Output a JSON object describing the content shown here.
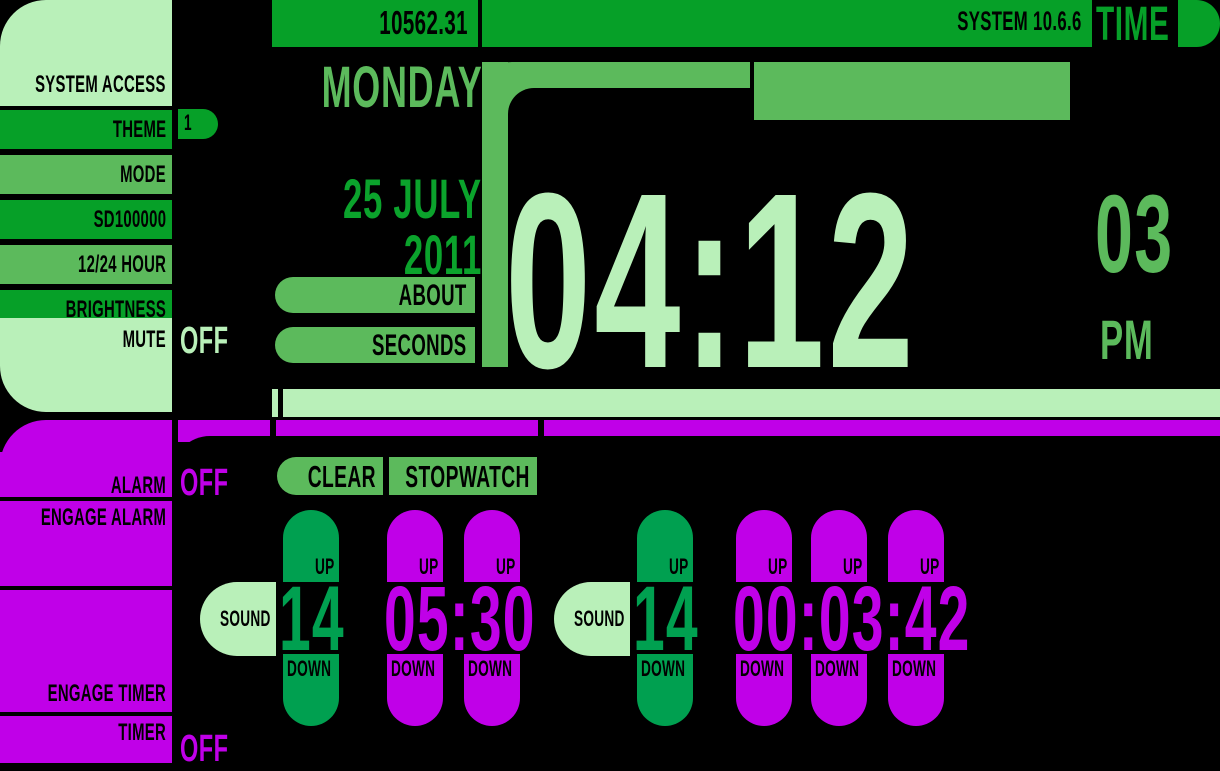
{
  "theme": {
    "light_green": "#b9f0b9",
    "green": "#06a028",
    "medium_green": "#5cba5c",
    "bright_green": "#0ba32c",
    "spinner_green": "#00a050",
    "purple": "#c000e8",
    "background": "#000000"
  },
  "header": {
    "stardate": "10562.31",
    "system_version": "SYSTEM 10.6.6",
    "title": "TIME"
  },
  "sidebar": {
    "system_access": "SYSTEM ACCESS",
    "items": [
      {
        "label": "THEME",
        "value": "1"
      },
      {
        "label": "MODE",
        "value": ""
      },
      {
        "label": "SD100000",
        "value": ""
      },
      {
        "label": "12/24 HOUR",
        "value": ""
      },
      {
        "label": "BRIGHTNESS",
        "value": ""
      },
      {
        "label": "MUTE",
        "value": "OFF"
      }
    ]
  },
  "clock": {
    "weekday": "MONDAY",
    "day_month": "25 JULY",
    "year": "2011",
    "time": "04:12",
    "hour_badge": "03",
    "ampm": "PM",
    "about_label": "ABOUT",
    "seconds_label": "SECONDS"
  },
  "bottom": {
    "alarm": {
      "label": "ALARM",
      "value": "OFF"
    },
    "engage_alarm": {
      "label": "ENGAGE ALARM"
    },
    "engage_timer": {
      "label": "ENGAGE TIMER"
    },
    "timer": {
      "label": "TIMER",
      "value": "OFF"
    },
    "clear_label": "CLEAR",
    "stopwatch_label": "STOPWATCH",
    "up_label": "UP",
    "down_label": "DOWN",
    "sound_label": "SOUND",
    "alarm_group": {
      "sound_value": "14",
      "digits": "05:30"
    },
    "timer_group": {
      "sound_value": "14",
      "digits": "00:03:42"
    }
  }
}
